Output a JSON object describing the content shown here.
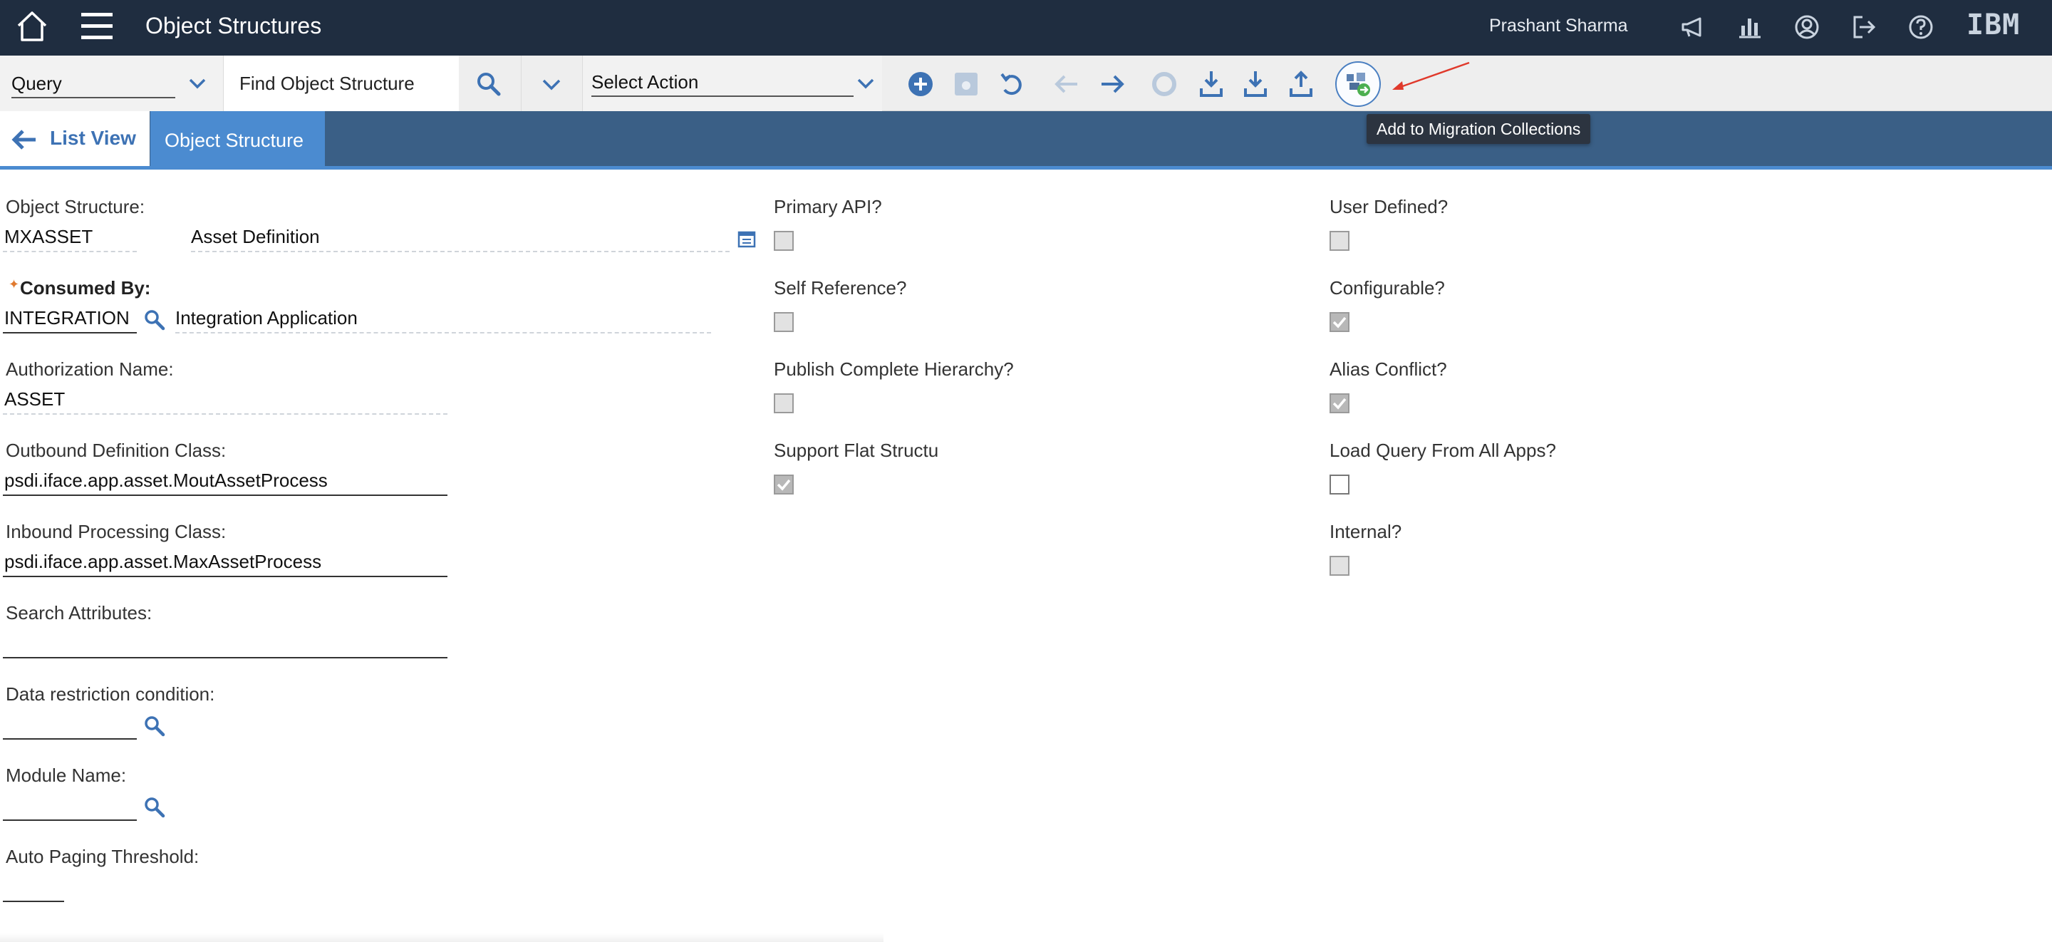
{
  "topbar": {
    "app_title": "Object Structures",
    "user_name": "Prashant Sharma",
    "logo_text": "IBM",
    "icons": [
      "home-icon",
      "menu-icon",
      "announcement-icon",
      "reports-icon",
      "profile-icon",
      "sign-out-icon",
      "help-icon"
    ]
  },
  "toolbar": {
    "query_value": "Query",
    "find_text": "Find Object Structure",
    "action_value": "Select Action",
    "icons": [
      "new-record-icon",
      "save-icon",
      "undo-icon",
      "previous-record-icon",
      "next-record-icon",
      "status-icon",
      "import-icon",
      "import-xml-icon",
      "export-icon",
      "migration-collection-icon"
    ],
    "tooltip": "Add to Migration Collections"
  },
  "tabs": {
    "list_view": "List View",
    "object_structure": "Object Structure"
  },
  "form": {
    "object_structure": {
      "label": "Object Structure:",
      "value": "MXASSET",
      "description": "Asset Definition"
    },
    "consumed_by": {
      "label": "Consumed By:",
      "value": "INTEGRATION",
      "description": "Integration Application"
    },
    "authorization_name": {
      "label": "Authorization Name:",
      "value": "ASSET"
    },
    "outbound_class": {
      "label": "Outbound Definition Class:",
      "value": "psdi.iface.app.asset.MoutAssetProcess"
    },
    "inbound_class": {
      "label": "Inbound Processing Class:",
      "value": "psdi.iface.app.asset.MaxAssetProcess"
    },
    "search_attributes": {
      "label": "Search Attributes:",
      "value": ""
    },
    "data_restriction": {
      "label": "Data restriction condition:",
      "value": ""
    },
    "module_name": {
      "label": "Module Name:",
      "value": ""
    },
    "auto_paging": {
      "label": "Auto Paging Threshold:",
      "value": ""
    }
  },
  "checkboxes": {
    "primary_api": {
      "label": "Primary API?",
      "checked": false
    },
    "self_reference": {
      "label": "Self Reference?",
      "checked": false
    },
    "publish_hierarchy": {
      "label": "Publish Complete Hierarchy?",
      "checked": false
    },
    "flat_structure": {
      "label": "Support Flat Structu",
      "checked": true
    },
    "user_defined": {
      "label": "User Defined?",
      "checked": false
    },
    "configurable": {
      "label": "Configurable?",
      "checked": true
    },
    "alias_conflict": {
      "label": "Alias Conflict?",
      "checked": true
    },
    "load_query": {
      "label": "Load Query From All Apps?",
      "checked": false
    },
    "internal": {
      "label": "Internal?",
      "checked": false
    }
  },
  "colors": {
    "topbar_bg": "#1f2d40",
    "tabstrip_bg": "#3a5f86",
    "active_tab": "#4b8bd0",
    "accent_blue": "#3d72b4",
    "annotation_red": "#e0392b"
  }
}
